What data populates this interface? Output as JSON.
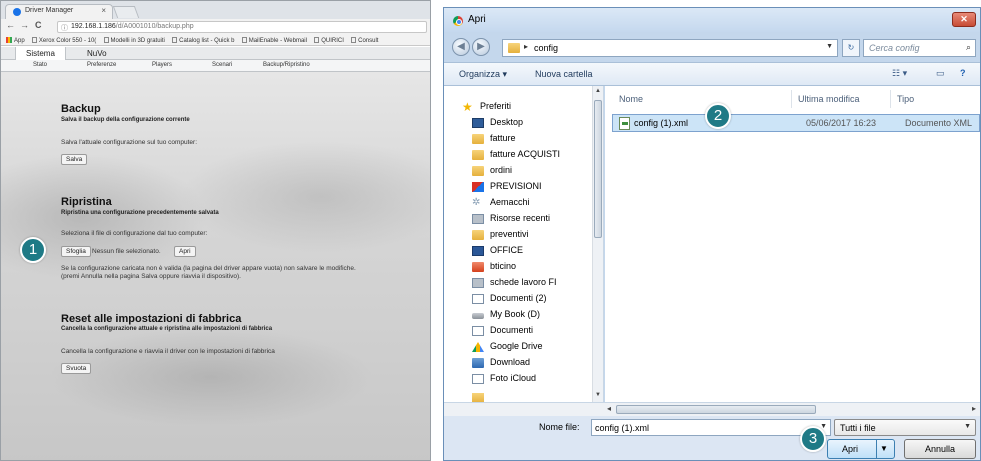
{
  "browser": {
    "tab_title": "Driver Manager",
    "tab_close": "×",
    "nav": {
      "back": "←",
      "forward": "→",
      "reload": "C"
    },
    "url_host": "192.168.1.186",
    "url_path": "/d/A0001010/backup.php",
    "bookmarks": [
      "App",
      "Xerox Color 550 - 10(",
      "Modelli in 3D gratuiti",
      "Catalog list - Quick b",
      "MailEnable - Webmail",
      "QUIRICI",
      "Consult"
    ]
  },
  "webapp": {
    "main_menu": [
      "Sistema",
      "NuVo"
    ],
    "sub_menu": [
      "Stato",
      "Preferenze",
      "Players",
      "Scenari",
      "Backup/Ripristino"
    ],
    "backup": {
      "title": "Backup",
      "subtitle": "Salva il backup della configurazione corrente",
      "text": "Salva l'attuale configurazione sul tuo computer:",
      "button": "Salva"
    },
    "restore": {
      "title": "Ripristina",
      "subtitle": "Ripristina una configurazione precedentemente salvata",
      "text": "Seleziona il file di configurazione dal tuo computer:",
      "browse_button": "Sfoglia",
      "no_file": "Nessun file selezionato.",
      "open_button": "Apri",
      "warning_1": "Se la configurazione caricata non è valida (la pagina del driver appare vuota) non salvare le modifiche.",
      "warning_2": "(premi Annulla nella pagina Salva oppure riavvia il dispositivo)."
    },
    "reset": {
      "title": "Reset alle impostazioni di fabbrica",
      "subtitle": "Cancella la configurazione attuale e ripristina alle impostazioni di fabbrica",
      "text": "Cancella la configurazione e riavvia il driver con le impostazioni di fabbrica",
      "button": "Svuota"
    }
  },
  "callouts": {
    "one": "1",
    "two": "2",
    "three": "3"
  },
  "dialog": {
    "title": "Apri",
    "close": "✕",
    "path_folder": "config",
    "search_placeholder": "Cerca config",
    "organize": "Organizza ▾",
    "new_folder": "Nuova cartella",
    "nav_items": [
      "Preferiti",
      "Desktop",
      "fatture",
      "fatture ACQUISTI",
      "ordini",
      "PREVISIONI",
      "Aemacchi",
      "Risorse recenti",
      "preventivi",
      "OFFICE",
      "bticino",
      "schede lavoro FI",
      "Documenti (2)",
      "My Book (D)",
      "Documenti",
      "Google Drive",
      "Download",
      "Foto iCloud"
    ],
    "columns": {
      "name": "Nome",
      "modified": "Ultima modifica",
      "type": "Tipo"
    },
    "files": [
      {
        "name": "config (1).xml",
        "modified": "05/06/2017 16:23",
        "type": "Documento XML"
      }
    ],
    "filename_label": "Nome file:",
    "filename_value": "config (1).xml",
    "filter_value": "Tutti i file",
    "open_button": "Apri",
    "cancel_button": "Annulla"
  },
  "colors": {
    "callout": "#1f7a86",
    "selection": "#cce4f7",
    "dialog_frame": "#c4d7ec"
  }
}
